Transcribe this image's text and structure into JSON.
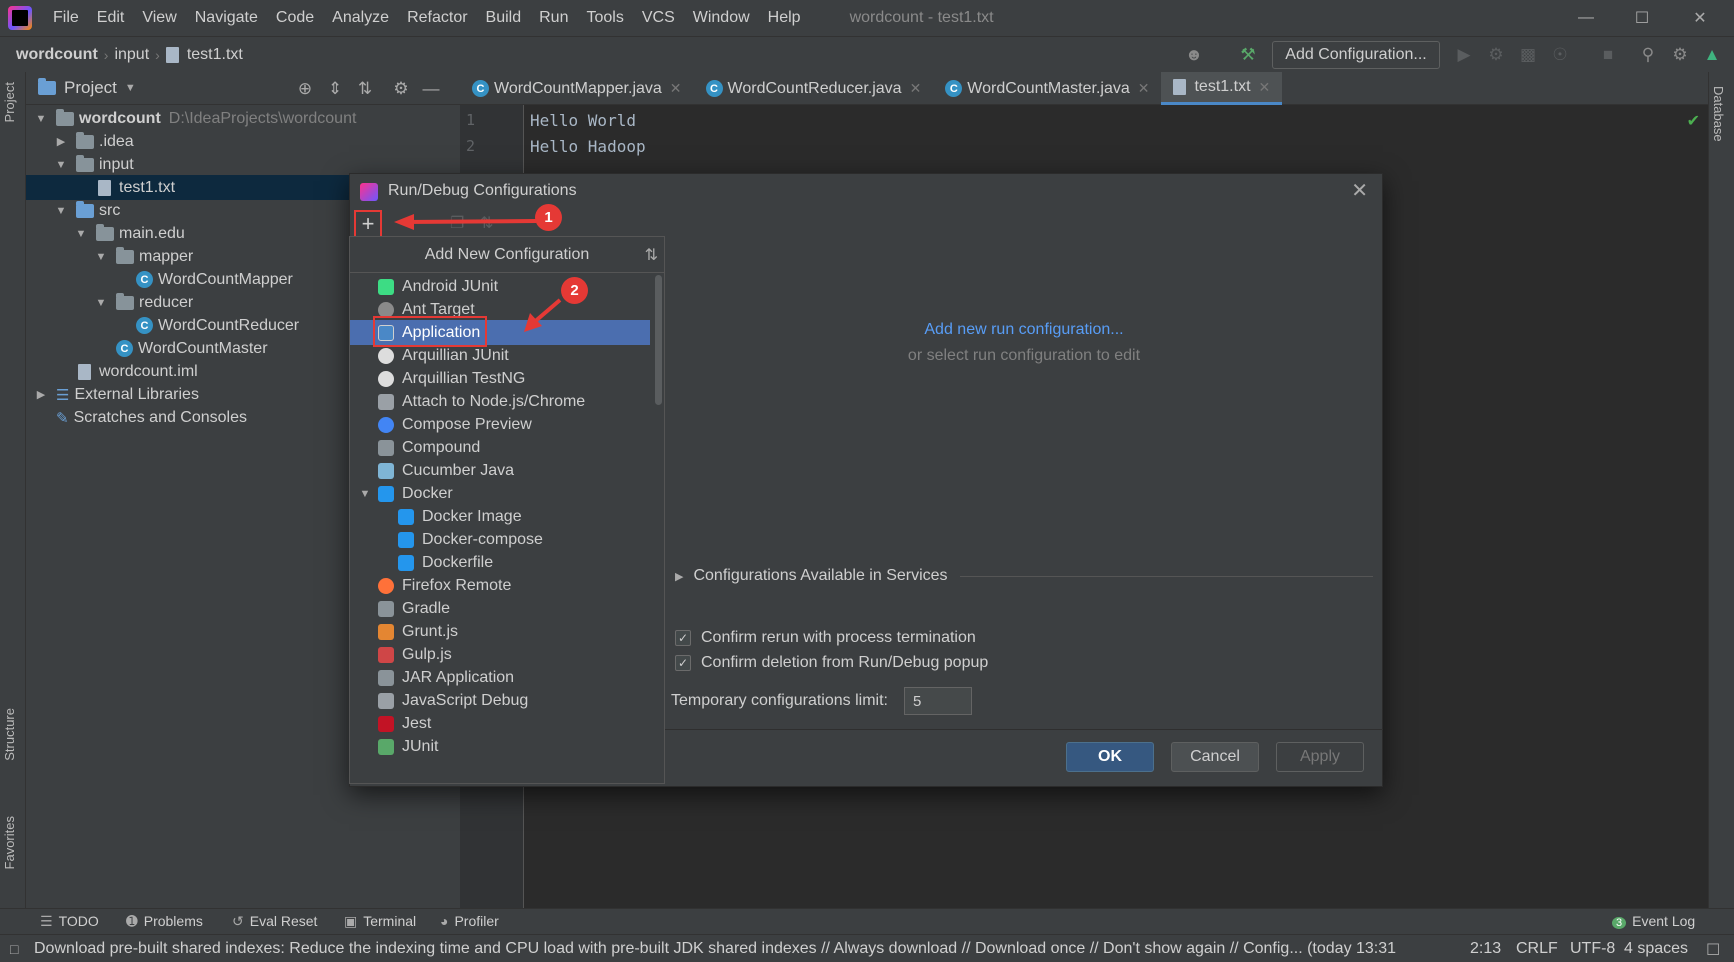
{
  "menubar": {
    "items": [
      "File",
      "Edit",
      "View",
      "Navigate",
      "Code",
      "Analyze",
      "Refactor",
      "Build",
      "Run",
      "Tools",
      "VCS",
      "Window",
      "Help"
    ],
    "window_title": "wordcount - test1.txt"
  },
  "navbar": {
    "breadcrumbs": [
      "wordcount",
      "input",
      "test1.txt"
    ],
    "add_config_label": "Add Configuration..."
  },
  "left_stripe": {
    "project": "Project",
    "structure": "Structure",
    "favorites": "Favorites"
  },
  "right_stripe": {
    "database": "Database"
  },
  "project_panel": {
    "title": "Project",
    "tree": [
      {
        "label": "wordcount",
        "extra": "D:\\IdeaProjects\\wordcount"
      },
      {
        "label": ".idea"
      },
      {
        "label": "input"
      },
      {
        "label": "test1.txt"
      },
      {
        "label": "src"
      },
      {
        "label": "main.edu"
      },
      {
        "label": "mapper"
      },
      {
        "label": "WordCountMapper"
      },
      {
        "label": "reducer"
      },
      {
        "label": "WordCountReducer"
      },
      {
        "label": "WordCountMaster"
      },
      {
        "label": "wordcount.iml"
      },
      {
        "label": "External Libraries"
      },
      {
        "label": "Scratches and Consoles"
      }
    ]
  },
  "editor_tabs": [
    "WordCountMapper.java",
    "WordCountReducer.java",
    "WordCountMaster.java",
    "test1.txt"
  ],
  "editor": {
    "line_numbers": [
      "1",
      "2"
    ],
    "lines": [
      "Hello World",
      "Hello Hadoop"
    ]
  },
  "dialog": {
    "title": "Run/Debug Configurations",
    "popup_title": "Add New Configuration",
    "config_types": [
      "Android JUnit",
      "Ant Target",
      "Application",
      "Arquillian JUnit",
      "Arquillian TestNG",
      "Attach to Node.js/Chrome",
      "Compose Preview",
      "Compound",
      "Cucumber Java",
      "Docker",
      "Docker Image",
      "Docker-compose",
      "Dockerfile",
      "Firefox Remote",
      "Gradle",
      "Grunt.js",
      "Gulp.js",
      "JAR Application",
      "JavaScript Debug",
      "Jest",
      "JUnit"
    ],
    "selected": "Application",
    "add_new_link": "Add new run configuration...",
    "or_select": "or select run configuration to edit",
    "services_label": "Configurations Available in Services",
    "confirm_rerun": "Confirm rerun with process termination",
    "confirm_deletion": "Confirm deletion from Run/Debug popup",
    "temp_limit_label": "Temporary configurations limit:",
    "temp_limit_value": "5",
    "ok_label": "OK",
    "cancel_label": "Cancel",
    "apply_label": "Apply"
  },
  "annotations": {
    "badge1": "1",
    "badge2": "2",
    "color": "#e53935"
  },
  "bottom_tools": {
    "todo": "TODO",
    "problems": "Problems",
    "eval_reset": "Eval Reset",
    "terminal": "Terminal",
    "profiler": "Profiler",
    "event_log": "Event Log",
    "event_count": "3"
  },
  "statusbar": {
    "message": "Download pre-built shared indexes: Reduce the indexing time and CPU load with pre-built JDK shared indexes // Always download // Download once // Don't show again // Config... (today 13:31",
    "position": "2:13",
    "line_sep": "CRLF",
    "encoding": "UTF-8",
    "indent": "4 spaces"
  }
}
